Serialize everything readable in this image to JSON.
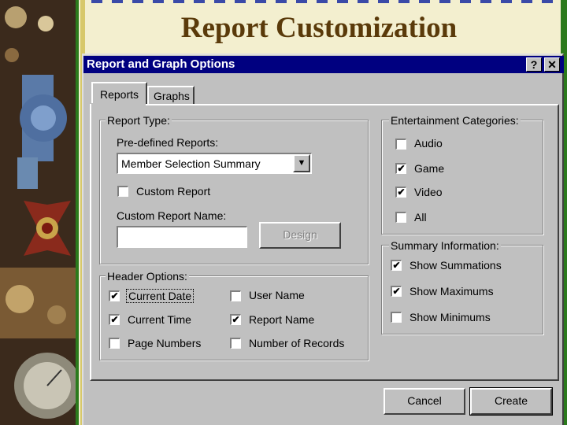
{
  "slide": {
    "title": "Report Customization"
  },
  "dialog": {
    "title": "Report and Graph Options",
    "help_glyph": "?",
    "close_glyph": "✕",
    "tabs": [
      "Reports",
      "Graphs"
    ],
    "report_type": {
      "legend": "Report Type:",
      "predefined_label": "Pre-defined Reports:",
      "predefined_value": "Member Selection Summary",
      "custom_report_label": "Custom Report",
      "custom_report_checked": false,
      "custom_name_label": "Custom Report Name:",
      "custom_name_value": "",
      "design_button": "Design"
    },
    "entertainment": {
      "legend": "Entertainment Categories:",
      "items": [
        {
          "label": "Audio",
          "checked": false
        },
        {
          "label": "Game",
          "checked": true
        },
        {
          "label": "Video",
          "checked": true
        },
        {
          "label": "All",
          "checked": false
        }
      ]
    },
    "header_options": {
      "legend": "Header Options:",
      "items": [
        {
          "label": "Current Date",
          "checked": true
        },
        {
          "label": "User Name",
          "checked": false
        },
        {
          "label": "Current Time",
          "checked": true
        },
        {
          "label": "Report Name",
          "checked": true
        },
        {
          "label": "Page Numbers",
          "checked": false
        },
        {
          "label": "Number of Records",
          "checked": false
        }
      ]
    },
    "summary": {
      "legend": "Summary Information:",
      "items": [
        {
          "label": "Show Summations",
          "checked": true
        },
        {
          "label": "Show Maximums",
          "checked": true
        },
        {
          "label": "Show Minimums",
          "checked": false
        }
      ]
    },
    "buttons": {
      "cancel": "Cancel",
      "create": "Create"
    }
  },
  "colors": {
    "titlebar": "#000080",
    "face": "#c0c0c0",
    "slide_title": "#5a3a0a",
    "slide_bg": "#f3efcf"
  },
  "icons": {
    "check": "✔",
    "dropdown": "▼"
  }
}
